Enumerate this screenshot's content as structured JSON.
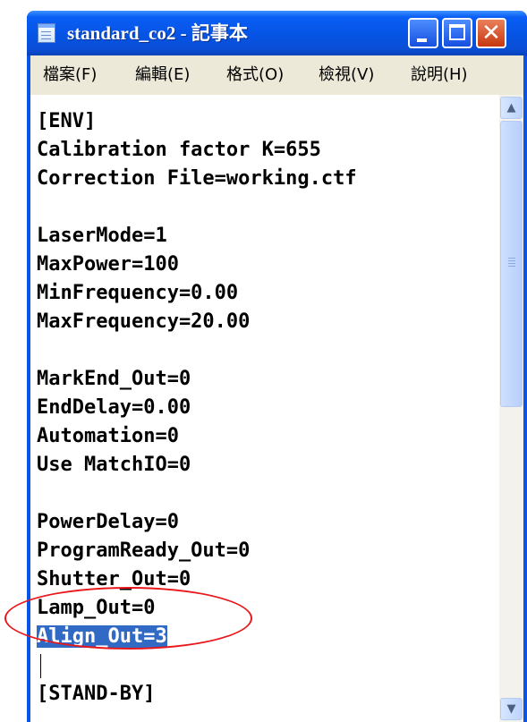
{
  "window": {
    "title": "standard_co2 - 記事本",
    "icon": "notepad-icon",
    "controls": {
      "minimize_icon": "minimize-icon",
      "maximize_icon": "maximize-icon",
      "close_icon": "close-icon"
    }
  },
  "menu": [
    "檔案(F)",
    "編輯(E)",
    "格式(O)",
    "檢視(V)",
    "說明(H)"
  ],
  "editor": {
    "lines": [
      "[ENV]",
      "Calibration factor K=655",
      "Correction File=working.ctf",
      "",
      "LaserMode=1",
      "MaxPower=100",
      "MinFrequency=0.00",
      "MaxFrequency=20.00",
      "",
      "MarkEnd_Out=0",
      "EndDelay=0.00",
      "Automation=0",
      "Use MatchIO=0",
      "",
      "PowerDelay=0",
      "ProgramReady_Out=0",
      "Shutter_Out=0",
      "Lamp_Out=0",
      "Align_Out=3",
      "",
      "[STAND-BY]"
    ],
    "selected_text": "Align_Out=3"
  },
  "colors": {
    "titlebar": "#0554e4",
    "selection": "#316ac5",
    "annotation": "#e8171c"
  }
}
